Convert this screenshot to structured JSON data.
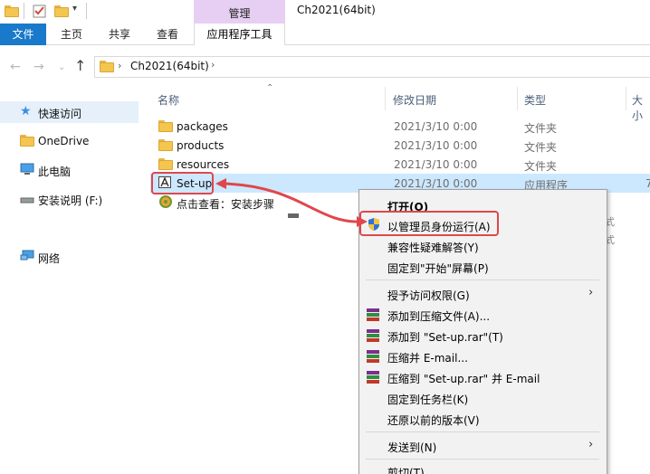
{
  "titlebar": {
    "context_tab": "管理",
    "window_title": "Ch2021(64bit)"
  },
  "ribbon": {
    "tabs": [
      "文件",
      "主页",
      "共享",
      "查看",
      "应用程序工具"
    ]
  },
  "address": {
    "path": "Ch2021(64bit)"
  },
  "sidebar": {
    "items": [
      {
        "label": "快速访问",
        "icon": "star-icon"
      },
      {
        "label": "OneDrive",
        "icon": "folder-icon"
      },
      {
        "label": "此电脑",
        "icon": "computer-icon"
      },
      {
        "label": "安装说明 (F:)",
        "icon": "drive-icon"
      },
      {
        "label": "网络",
        "icon": "network-icon"
      }
    ]
  },
  "columns": {
    "name": "名称",
    "date": "修改日期",
    "type": "类型",
    "size": "大小"
  },
  "files": [
    {
      "name": "packages",
      "date": "2021/3/10 0:00",
      "type": "文件夹",
      "icon": "folder-icon"
    },
    {
      "name": "products",
      "date": "2021/3/10 0:00",
      "type": "文件夹",
      "icon": "folder-icon"
    },
    {
      "name": "resources",
      "date": "2021/3/10 0:00",
      "type": "文件夹",
      "icon": "folder-icon"
    },
    {
      "name": "Set-up",
      "date": "2021/3/10 0:00",
      "type": "应用程序",
      "size_fragment": "7",
      "icon": "adobe-app-icon"
    },
    {
      "name": "点击查看：安装步骤",
      "icon": "browser-link-icon"
    }
  ],
  "context_menu": {
    "items": [
      {
        "label": "打开(O)",
        "bold": true
      },
      {
        "label": "以管理员身份运行(A)",
        "icon": "uac-shield-icon"
      },
      {
        "label": "兼容性疑难解答(Y)"
      },
      {
        "label": "固定到\"开始\"屏幕(P)"
      },
      {
        "label": "授予访问权限(G)",
        "submenu": true
      },
      {
        "label": "添加到压缩文件(A)...",
        "icon": "winrar-icon"
      },
      {
        "label": "添加到 \"Set-up.rar\"(T)",
        "icon": "winrar-icon"
      },
      {
        "label": "压缩并 E-mail...",
        "icon": "winrar-icon"
      },
      {
        "label": "压缩到 \"Set-up.rar\" 并 E-mail",
        "icon": "winrar-icon"
      },
      {
        "label": "固定到任务栏(K)"
      },
      {
        "label": "还原以前的版本(V)"
      },
      {
        "label": "发送到(N)",
        "submenu": true
      },
      {
        "label": "剪切(T)"
      }
    ]
  },
  "colors": {
    "file_tab": "#1979ca",
    "manage_tab": "#e6cff3",
    "selection": "#cce8ff",
    "annotation_red": "#e0474c"
  }
}
